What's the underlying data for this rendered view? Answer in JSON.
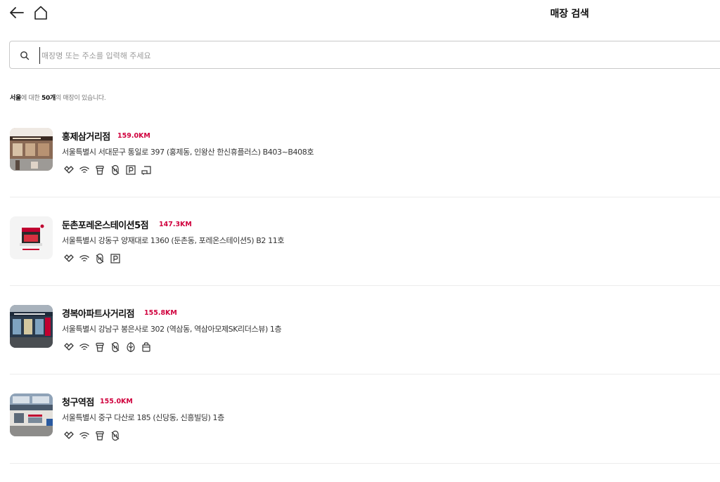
{
  "header": {
    "title": "매장 검색"
  },
  "search": {
    "placeholder": "매장명 또는 주소를 입력해 주세요",
    "value": ""
  },
  "result": {
    "region": "서울",
    "mid1": "에 대한 ",
    "count": "50개",
    "mid2": "의 매장이 있습니다."
  },
  "colors": {
    "accent": "#d0003d"
  },
  "stores": [
    {
      "name": "홍제삼거리점",
      "distance": "159.0KM",
      "address": "서울특별시 서대문구 통일로 397 (홍제동, 인왕산 한신휴플러스) B403~B408호",
      "icons": [
        "delivery-icon",
        "wifi-icon",
        "cup-icon",
        "no-straw-icon",
        "parking-icon",
        "drive-icon"
      ]
    },
    {
      "name": "둔촌포레온스테이션5점",
      "distance": "147.3KM",
      "address": "서울특별시 강동구 양재대로 1360 (둔촌동, 포레온스테이션5) B2 11호",
      "icons": [
        "delivery-icon",
        "wifi-icon",
        "no-straw-icon",
        "parking-icon"
      ]
    },
    {
      "name": "경복아파트사거리점",
      "distance": "155.8KM",
      "address": "서울특별시 강남구 봉은사로 302 (역삼동, 역삼아모제SK리더스뷰) 1층",
      "icons": [
        "delivery-icon",
        "wifi-icon",
        "cup-icon",
        "no-straw-icon",
        "bean-icon",
        "bag-icon"
      ]
    },
    {
      "name": "청구역점",
      "distance": "155.0KM",
      "address": "서울특별시 중구 다산로 185 (신당동, 신흥빌딩) 1층",
      "icons": [
        "delivery-icon",
        "wifi-icon",
        "cup-icon",
        "no-straw-icon"
      ]
    }
  ]
}
